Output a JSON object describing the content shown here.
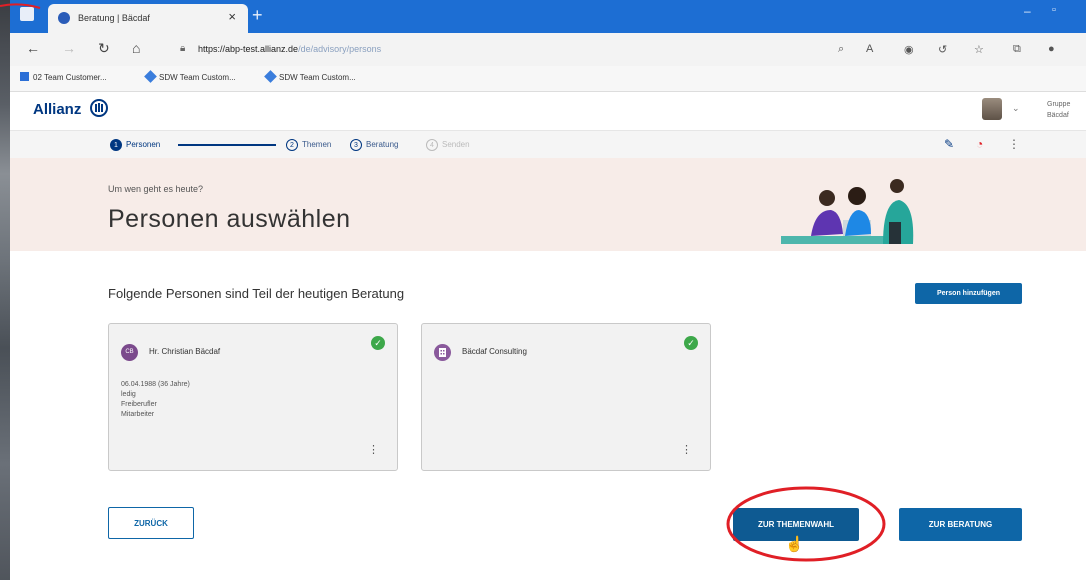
{
  "browser": {
    "tab_title": "Beratung | Bäcdaf",
    "tab_close": "×",
    "new_tab": "+",
    "url_host": "https://abp-test.allianz.de",
    "url_path": "/de/advisory/persons",
    "window_min": "–",
    "window_max": "▫",
    "bookmarks": [
      {
        "label": "02 Team Customer...",
        "icon_color": "#2b6fd6"
      },
      {
        "label": "SDW Team Custom...",
        "icon_color": "#3a7ddc"
      },
      {
        "label": "SDW Team Custom...",
        "icon_color": "#3a7ddc"
      }
    ]
  },
  "app": {
    "logo_text": "Allianz",
    "group_line1": "Gruppe",
    "group_line2": "Bäcdaf"
  },
  "stepper": {
    "steps": [
      {
        "number": "1",
        "label": "Personen",
        "state": "active"
      },
      {
        "number": "2",
        "label": "Themen",
        "state": "pending"
      },
      {
        "number": "3",
        "label": "Beratung",
        "state": "pending"
      },
      {
        "number": "4",
        "label": "Senden",
        "state": "disabled"
      }
    ]
  },
  "hero": {
    "subtitle": "Um wen geht es heute?",
    "title": "Personen auswählen"
  },
  "main": {
    "section_title": "Folgende Personen sind Teil der heutigen Beratung",
    "add_person_label": "Person hinzufügen",
    "cards": [
      {
        "initials": "CB",
        "name": "Hr. Christian Bäcdaf",
        "details": [
          "06.04.1988 (36 Jahre)",
          "ledig",
          "Freiberufler",
          "Mitarbeiter"
        ],
        "selected": true,
        "avatar_color": "#7b4a8c"
      },
      {
        "initials": "",
        "name": "Bäcdaf Consulting",
        "details": [],
        "selected": true,
        "avatar_color": "#8a5a9c"
      }
    ],
    "more_glyph": "⋮",
    "check_glyph": "✓"
  },
  "footer": {
    "back_label": "ZURÜCK",
    "themen_label": "ZUR THEMENWAHL",
    "beratung_label": "ZUR BERATUNG"
  },
  "colors": {
    "brand_blue": "#003781",
    "button_blue": "#0e66a7",
    "highlight_red": "#e01f26",
    "hero_bg": "#f7ece8",
    "success_green": "#3da84a"
  }
}
